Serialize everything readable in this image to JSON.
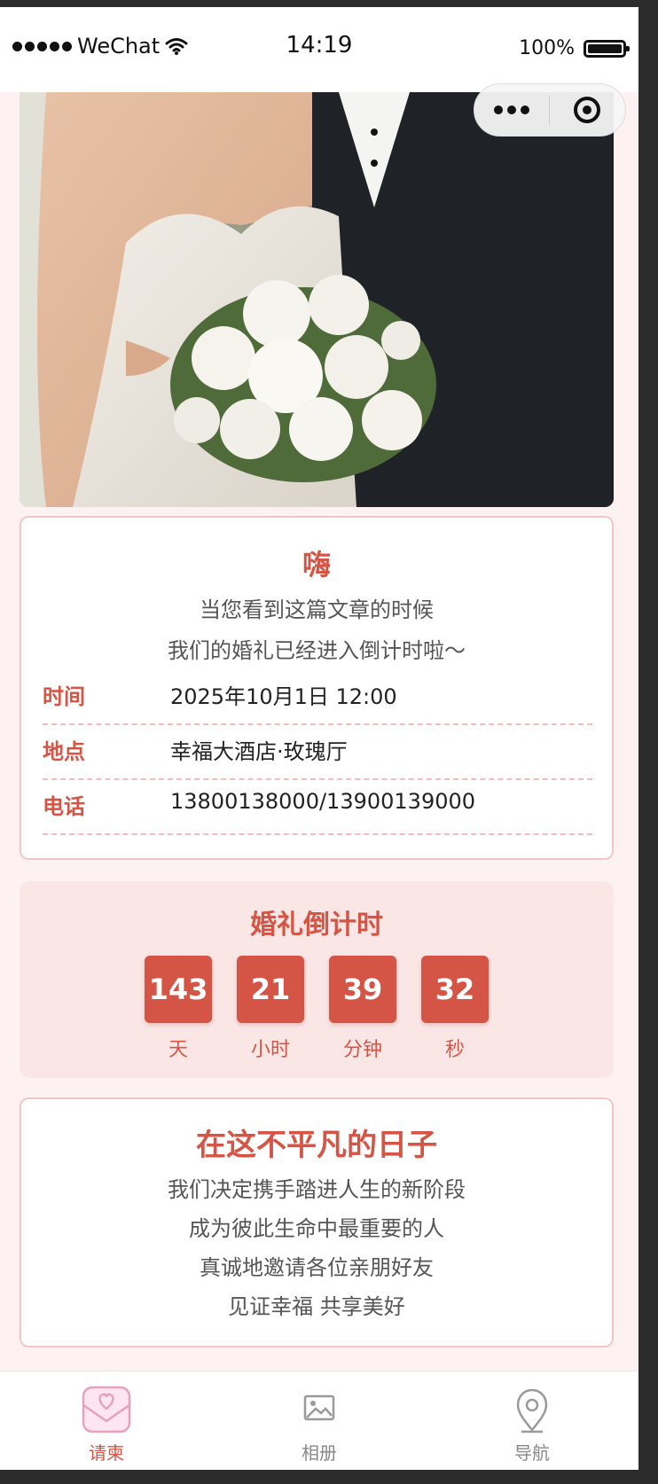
{
  "status_bar": {
    "carrier": "WeChat",
    "time": "14:19",
    "battery": "100%"
  },
  "invitation": {
    "greeting": "嗨",
    "intro_line1": "当您看到这篇文章的时候",
    "intro_line2": "我们的婚礼已经进入倒计时啦～",
    "details": [
      {
        "label": "时间",
        "value": "2025年10月1日 12:00"
      },
      {
        "label": "地点",
        "value": "幸福大酒店·玫瑰厅"
      },
      {
        "label": "电话",
        "value": "13800138000/13900139000"
      }
    ]
  },
  "countdown": {
    "title": "婚礼倒计时",
    "items": [
      {
        "value": "143",
        "unit": "天"
      },
      {
        "value": "21",
        "unit": "小时"
      },
      {
        "value": "39",
        "unit": "分钟"
      },
      {
        "value": "32",
        "unit": "秒"
      }
    ]
  },
  "message": {
    "title": "在这不平凡的日子",
    "lines": [
      "我们决定携手踏进人生的新阶段",
      "成为彼此生命中最重要的人",
      "真诚地邀请各位亲朋好友",
      "见证幸福 共享美好"
    ]
  },
  "tabbar": {
    "items": [
      {
        "label": "请柬",
        "icon": "envelope-heart-icon",
        "active": true
      },
      {
        "label": "相册",
        "icon": "image-icon",
        "active": false
      },
      {
        "label": "导航",
        "icon": "location-pin-icon",
        "active": false
      }
    ]
  },
  "colors": {
    "accent": "#d45545",
    "page_bg": "#fdf1f1",
    "countdown_bg": "#fbe6e6",
    "card_border": "#f3c6c6"
  }
}
